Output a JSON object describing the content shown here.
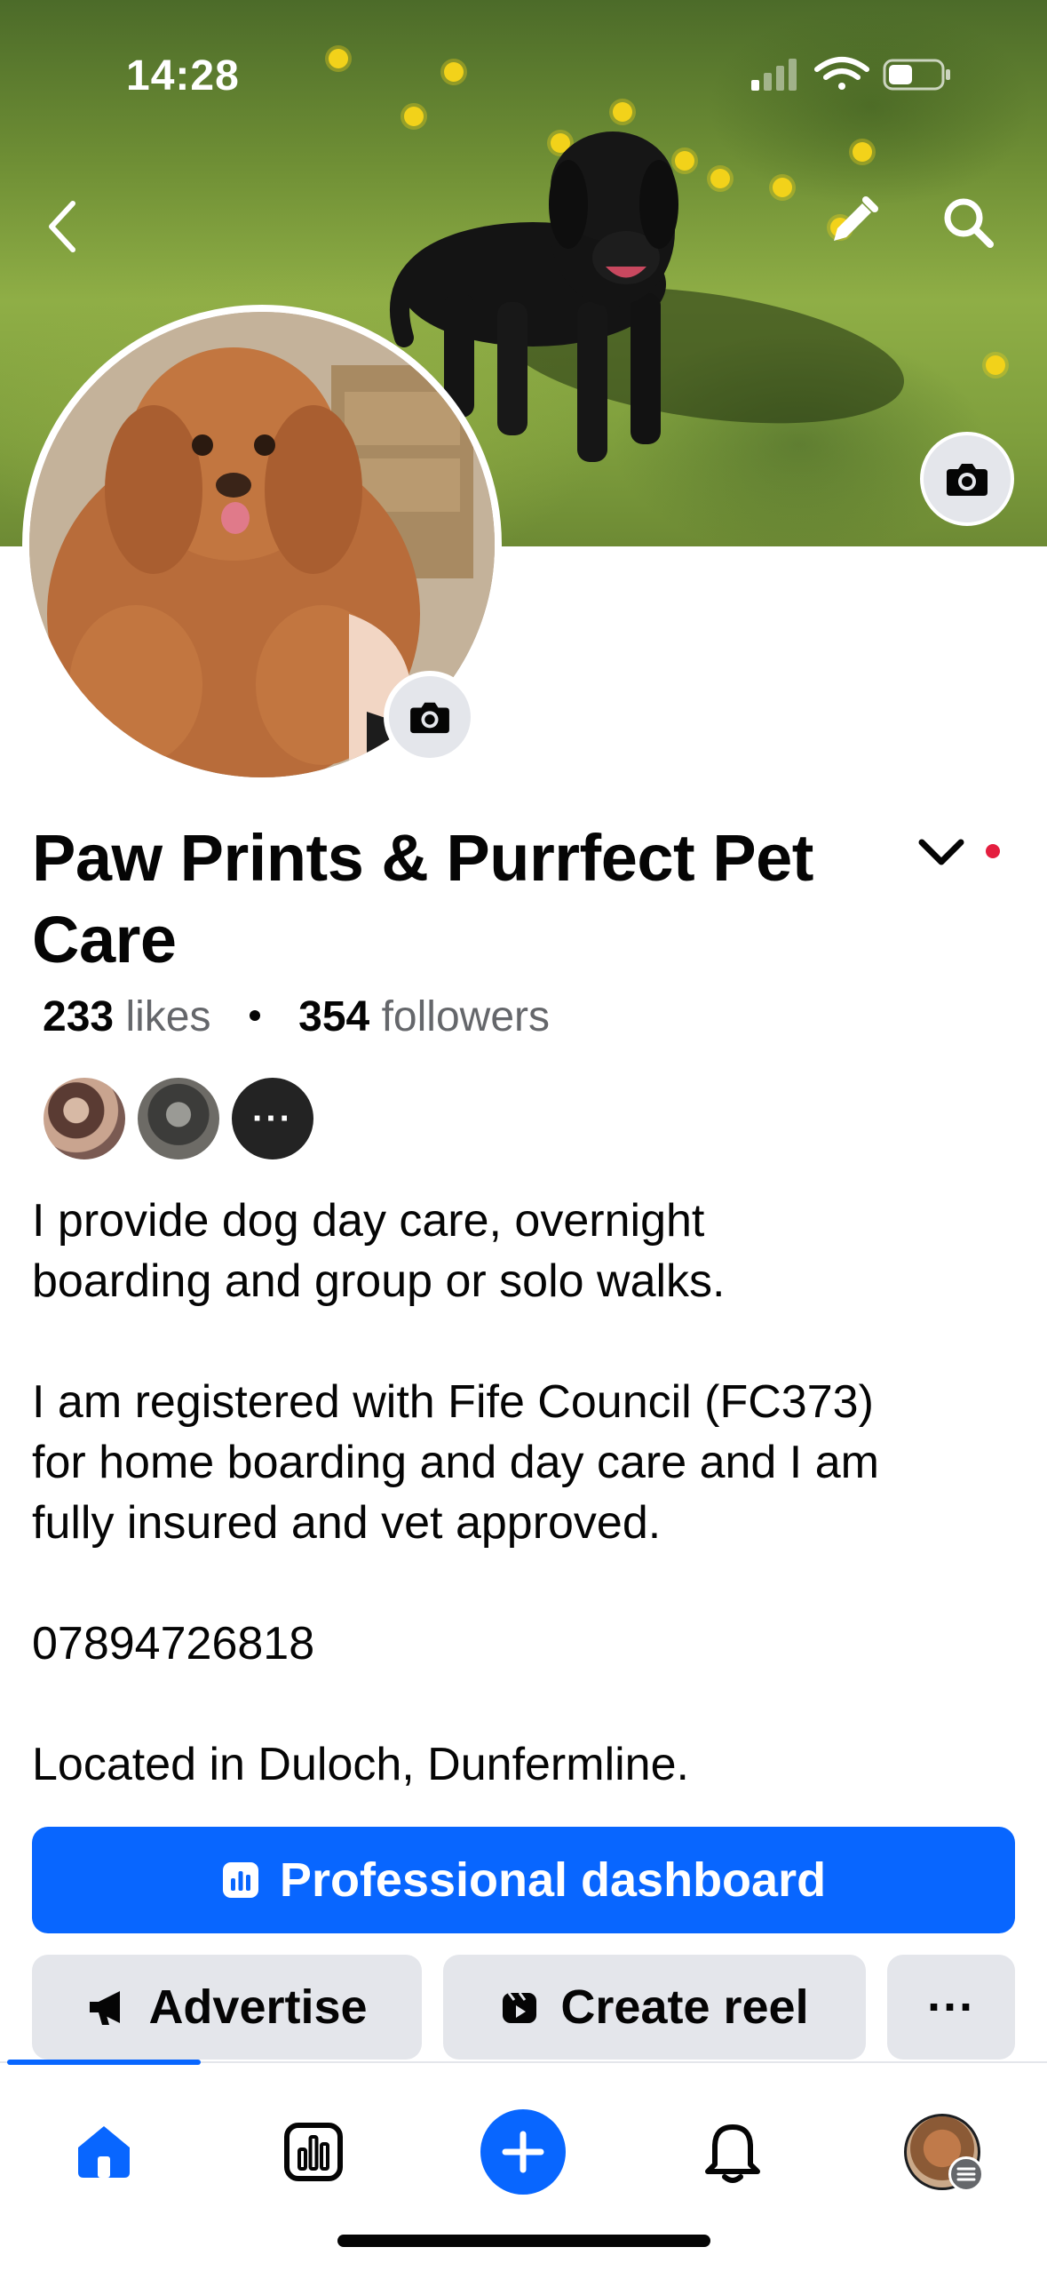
{
  "status_bar": {
    "time": "14:28"
  },
  "profile": {
    "name": "Paw Prints & Purrfect Pet Care",
    "likes_count": "233",
    "likes_label": "likes",
    "followers_count": "354",
    "followers_label": "followers",
    "friends_more_label": "···"
  },
  "bio": {
    "paragraphs": [
      "I provide dog day care, overnight\nboarding and group or solo walks.",
      "I am registered with Fife Council (FC373)\nfor home boarding and day care and I am\nfully insured and vet approved.",
      "07894726818",
      "Located in Duloch, Dunfermline."
    ]
  },
  "actions": {
    "professional_dashboard": "Professional dashboard",
    "advertise": "Advertise",
    "create_reel": "Create reel",
    "more": "···"
  },
  "icons": {
    "back": "chevron-left-icon",
    "edit": "pencil-icon",
    "search": "search-icon",
    "camera": "camera-icon",
    "dropdown": "chevron-down-icon",
    "home": "home-icon",
    "dashboard": "bar-chart-icon",
    "create": "plus-icon",
    "notifications": "bell-icon"
  },
  "colors": {
    "brand_blue": "#0866ff",
    "button_gray": "#e4e6eb",
    "notification_dot": "#e41e3f",
    "secondary_text": "#65676b"
  }
}
